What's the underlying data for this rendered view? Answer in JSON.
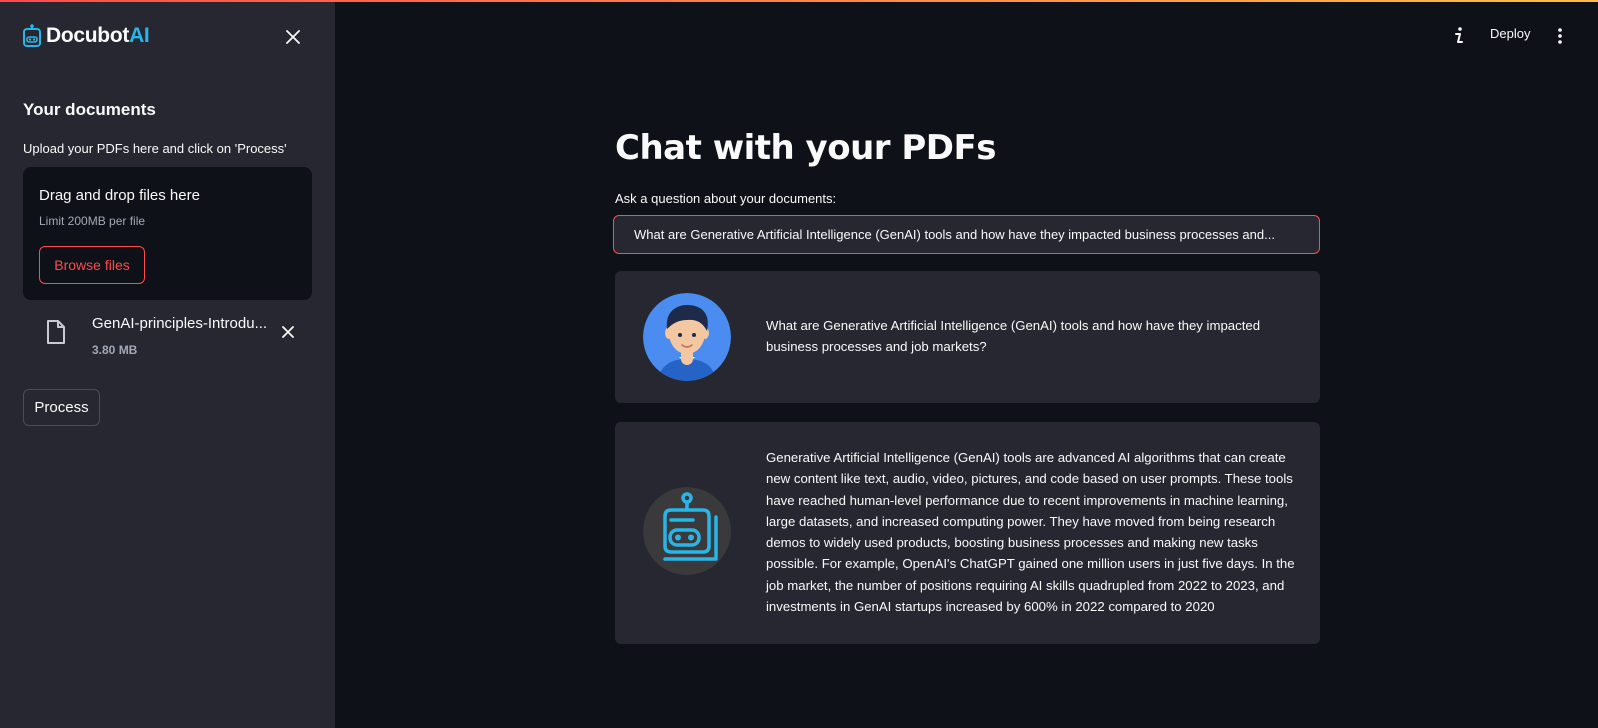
{
  "app": {
    "brand_part1": "Docubot",
    "brand_part2": "AI",
    "accent_color": "#ff4b4b",
    "brand_color": "#29b5e8"
  },
  "sidebar": {
    "heading": "Your documents",
    "upload_label": "Upload your PDFs here and click on 'Process'",
    "dropzone": {
      "title": "Drag and drop files here",
      "limit": "Limit 200MB per file",
      "browse_label": "Browse files"
    },
    "file": {
      "name": "GenAI-principles-Introdu...",
      "size": "3.80 MB"
    },
    "process_label": "Process"
  },
  "toolbar": {
    "deploy_label": "Deploy"
  },
  "main": {
    "title": "Chat with your PDFs",
    "question_label": "Ask a question about your documents:",
    "question_value": "What are Generative Artificial Intelligence (GenAI) tools and how have they impacted business processes and...",
    "messages": [
      {
        "role": "user",
        "avatar": "user-avatar-icon",
        "text": "What are Generative Artificial Intelligence (GenAI) tools and how have they impacted business processes and job markets?"
      },
      {
        "role": "bot",
        "avatar": "robot-avatar-icon",
        "text": "Generative Artificial Intelligence (GenAI) tools are advanced AI algorithms that can create new content like text, audio, video, pictures, and code based on user prompts. These tools have reached human-level performance due to recent improvements in machine learning, large datasets, and increased computing power. They have moved from being research demos to widely used products, boosting business processes and making new tasks possible. For example, OpenAI's ChatGPT gained one million users in just five days. In the job market, the number of positions requiring AI skills quadrupled from 2022 to 2023, and investments in GenAI startups increased by 600% in 2022 compared to 2020"
      }
    ]
  }
}
